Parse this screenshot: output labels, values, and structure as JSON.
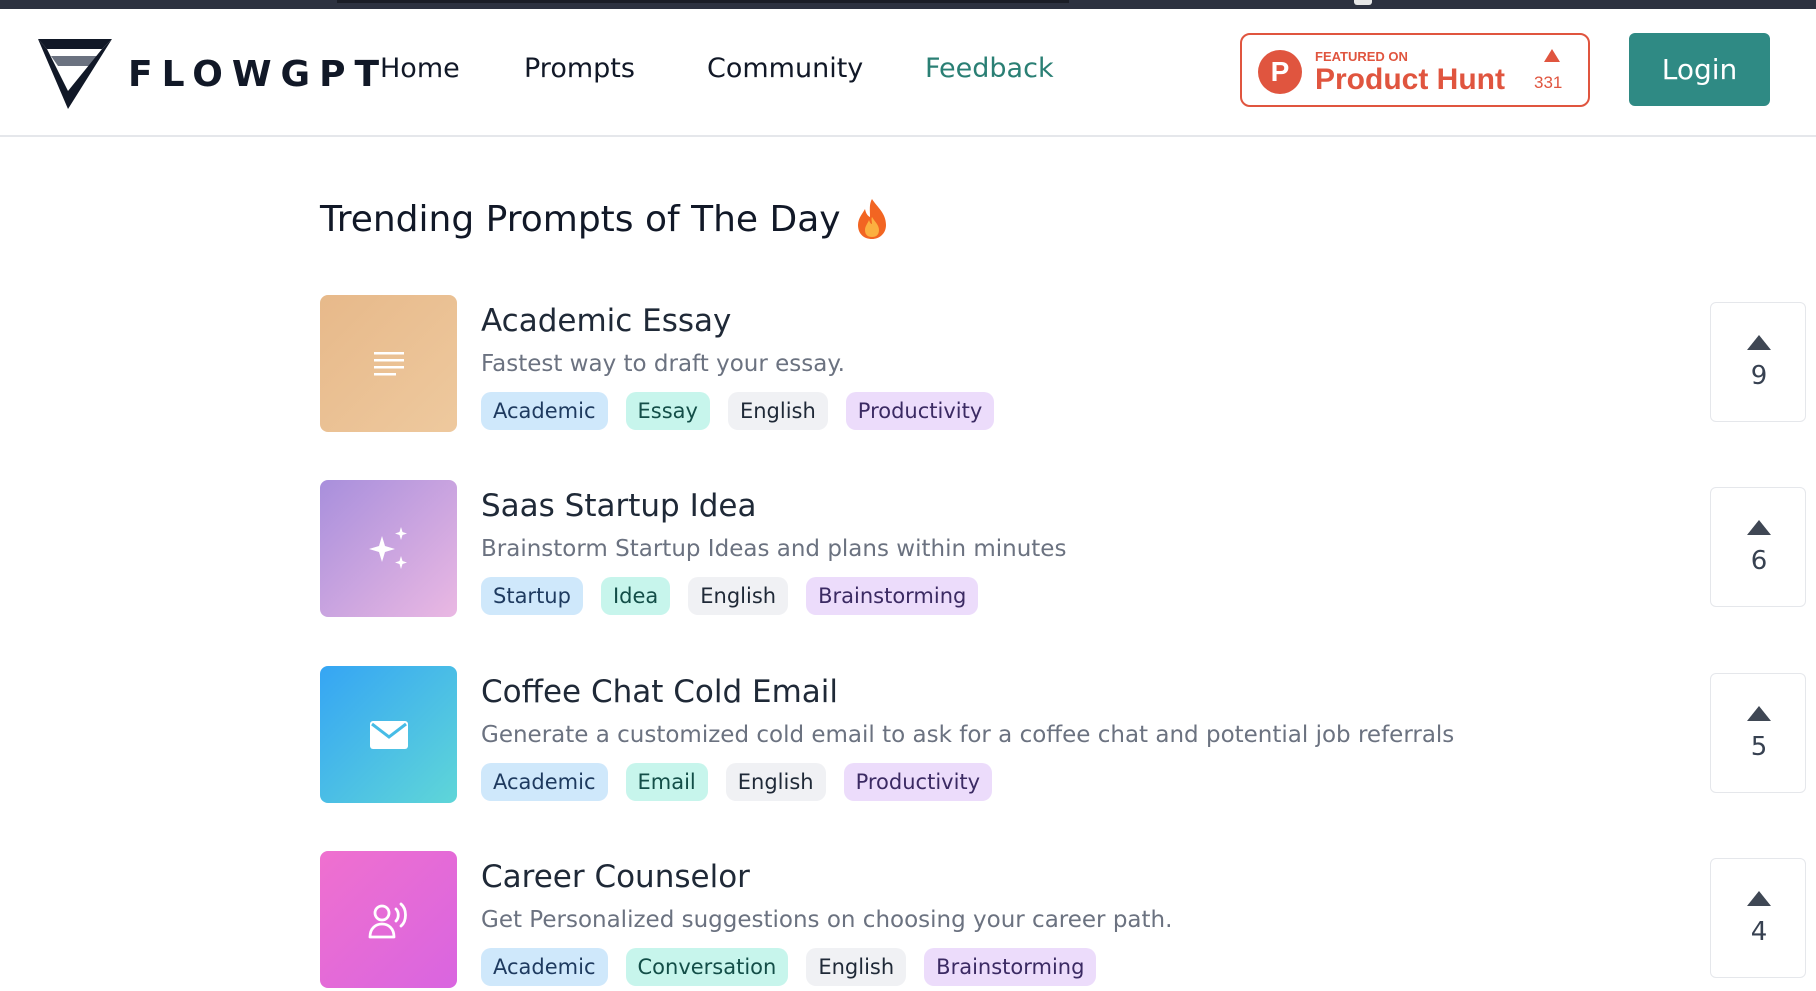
{
  "header": {
    "brand": "FLOWGPT",
    "nav": {
      "home": "Home",
      "prompts": "Prompts",
      "community": "Community",
      "feedback": "Feedback"
    },
    "product_hunt": {
      "featured": "FEATURED ON",
      "name": "Product Hunt",
      "count": "331",
      "brand_color": "#e0553f"
    },
    "login": "Login",
    "accent_color": "#2f8a84"
  },
  "section": {
    "title": "Trending Prompts of The Day",
    "title_icon": "fire-icon"
  },
  "prompts": [
    {
      "title": "Academic Essay",
      "description": "Fastest way to draft your essay.",
      "icon": "document-lines-icon",
      "tags": [
        "Academic",
        "Essay",
        "English",
        "Productivity"
      ],
      "votes": "9"
    },
    {
      "title": "Saas Startup Idea",
      "description": "Brainstorm Startup Ideas and plans within minutes",
      "icon": "sparkles-icon",
      "tags": [
        "Startup",
        "Idea",
        "English",
        "Brainstorming"
      ],
      "votes": "6"
    },
    {
      "title": "Coffee Chat Cold Email",
      "description": "Generate a customized cold email to ask for a coffee chat and potential job referrals",
      "icon": "mail-icon",
      "tags": [
        "Academic",
        "Email",
        "English",
        "Productivity"
      ],
      "votes": "5"
    },
    {
      "title": "Career Counselor",
      "description": "Get Personalized suggestions on choosing your career path.",
      "icon": "person-speaking-icon",
      "tags": [
        "Academic",
        "Conversation",
        "English",
        "Brainstorming"
      ],
      "votes": "4"
    }
  ]
}
